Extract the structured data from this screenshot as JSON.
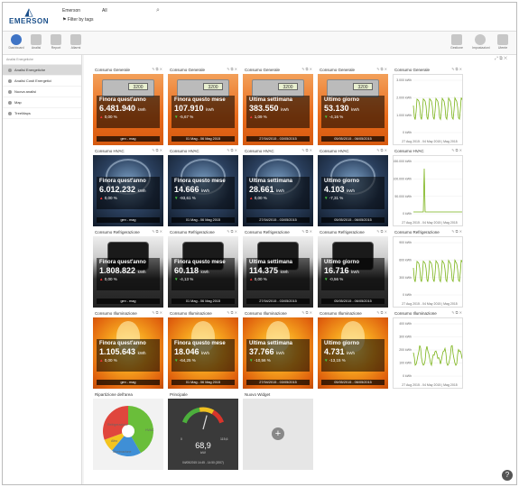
{
  "brand": {
    "name": "EMERSON"
  },
  "site": {
    "selector_label": "Emerson",
    "filter_label": "Filter by tags",
    "all_label": "All"
  },
  "toolbar": {
    "left": [
      "Dashboard",
      "Analisi",
      "Report",
      "Allarmi"
    ],
    "right": [
      "Gestione",
      "Impostazioni",
      "Utente"
    ]
  },
  "sidebar": {
    "header": "Analisi Energetiche",
    "items": [
      {
        "label": "Analisi Energetiche"
      },
      {
        "label": "Analisi Costi Energetici"
      },
      {
        "label": "Nuova analisi"
      },
      {
        "label": "Map"
      },
      {
        "label": "TreeMaps"
      }
    ]
  },
  "rows": [
    {
      "style": "orange",
      "widgets": [
        {
          "title": "Consumo Generale",
          "kpi": "Finora quest'anno",
          "value": "6.481.940",
          "unit": "kWh",
          "pct": "0,00 %",
          "dir": "up",
          "foot": "gen - mag"
        },
        {
          "title": "Consumo Generale",
          "kpi": "Finora questo mese",
          "value": "107.910",
          "unit": "kWh",
          "pct": "-5,67 %",
          "dir": "down",
          "foot": "01 Mag - 06 Mag 2015"
        },
        {
          "title": "Consumo Generale",
          "kpi": "Ultima settimana",
          "value": "383.550",
          "unit": "kWh",
          "pct": "1,09 %",
          "dir": "up",
          "foot": "27/04/2015 - 03/05/2015"
        },
        {
          "title": "Consumo Generale",
          "kpi": "Ultimo giorno",
          "value": "53.130",
          "unit": "kWh",
          "pct": "-4,16 %",
          "dir": "down",
          "foot": "05/05/2015 - 06/05/2015"
        }
      ]
    },
    {
      "style": "hvac",
      "widgets": [
        {
          "title": "Consumo HVAC",
          "kpi": "Finora quest'anno",
          "value": "6.012.232",
          "unit": "kWh",
          "pct": "0,00 %",
          "dir": "up",
          "foot": "gen - mag"
        },
        {
          "title": "Consumo HVAC",
          "kpi": "Finora questo mese",
          "value": "14.666",
          "unit": "kWh",
          "pct": "-93,61 %",
          "dir": "down",
          "foot": "01 Mag - 06 Mag 2015"
        },
        {
          "title": "Consumo HVAC",
          "kpi": "Ultima settimana",
          "value": "28.661",
          "unit": "kWh",
          "pct": "0,00 %",
          "dir": "up",
          "foot": "27/04/2015 - 03/05/2015"
        },
        {
          "title": "Consumo HVAC",
          "kpi": "Ultimo giorno",
          "value": "4.103",
          "unit": "kWh",
          "pct": "-7,31 %",
          "dir": "down",
          "foot": "05/05/2015 - 06/05/2015"
        }
      ]
    },
    {
      "style": "fridge",
      "widgets": [
        {
          "title": "Consumo Refrigerazione",
          "kpi": "Finora quest'anno",
          "value": "1.808.822",
          "unit": "kWh",
          "pct": "0,00 %",
          "dir": "up",
          "foot": "gen - mag"
        },
        {
          "title": "Consumo Refrigerazione",
          "kpi": "Finora questo mese",
          "value": "60.118",
          "unit": "kWh",
          "pct": "-4,13 %",
          "dir": "down",
          "foot": "01 Mag - 06 Mag 2015"
        },
        {
          "title": "Consumo Refrigerazione",
          "kpi": "Ultima settimana",
          "value": "114.375",
          "unit": "kWh",
          "pct": "0,00 %",
          "dir": "up",
          "foot": "27/04/2015 - 03/05/2015"
        },
        {
          "title": "Consumo Refrigerazione",
          "kpi": "Ultimo giorno",
          "value": "16.716",
          "unit": "kWh",
          "pct": "-0,56 %",
          "dir": "down",
          "foot": "05/05/2015 - 06/05/2015"
        }
      ]
    },
    {
      "style": "light",
      "widgets": [
        {
          "title": "Consumo Illuminazione",
          "kpi": "Finora quest'anno",
          "value": "1.105.643",
          "unit": "kWh",
          "pct": "0,00 %",
          "dir": "up",
          "foot": "gen - mag"
        },
        {
          "title": "Consumo Illuminazione",
          "kpi": "Finora questo mese",
          "value": "18.046",
          "unit": "kWh",
          "pct": "-64,25 %",
          "dir": "down",
          "foot": "01 Mag - 06 Mag 2015"
        },
        {
          "title": "Consumo Illuminazione",
          "kpi": "Ultima settimana",
          "value": "37.766",
          "unit": "kWh",
          "pct": "-10,56 %",
          "dir": "down",
          "foot": "27/04/2015 - 03/05/2015"
        },
        {
          "title": "Consumo Illuminazione",
          "kpi": "Ultimo giorno",
          "value": "4.731",
          "unit": "kWh",
          "pct": "-13,15 %",
          "dir": "down",
          "foot": "05/05/2015 - 06/05/2015"
        }
      ]
    }
  ],
  "trend_charts": [
    {
      "title": "Consumo Generale",
      "yticks": [
        "3.000 kWh",
        "2.000 kWh",
        "1.000 kWh",
        "0 kWh"
      ],
      "caption": "27 Aug 2015 - 04 May 2015 | Mag 2015"
    },
    {
      "title": "Consumo HVAC",
      "yticks": [
        "150.000 kWh",
        "100.000 kWh",
        "50.000 kWh",
        "0 kWh"
      ],
      "caption": "27 Aug 2015 - 04 May 2015 | Mag 2015"
    },
    {
      "title": "Consumo Refrigerazione",
      "yticks": [
        "900 kWh",
        "600 kWh",
        "300 kWh",
        "0 kWh"
      ],
      "caption": "27 Aug 2015 - 04 May 2015 | Mag 2015"
    },
    {
      "title": "Consumo Illuminazione",
      "yticks": [
        "400 kWh",
        "300 kWh",
        "200 kWh",
        "100 kWh",
        "0 kWh"
      ],
      "caption": "27 Aug 2015 - 04 May 2015 | Mag 2015"
    }
  ],
  "bottom": {
    "pie": {
      "title": "Ripartizione dell'area",
      "labels": [
        "HVAC",
        "Illuminazione",
        "Altro",
        "Refrigerazione"
      ]
    },
    "gauge": {
      "title": "Principale",
      "value": "68,9",
      "unit": "kW",
      "min": "0",
      "max": "115,6",
      "caption": "04/05/2015 14:45 - 14:50 (2007)"
    },
    "new": {
      "title": "Nuovo Widget"
    }
  },
  "colors": {
    "accent": "#3f74c5",
    "trend_line": "#7ab317"
  }
}
